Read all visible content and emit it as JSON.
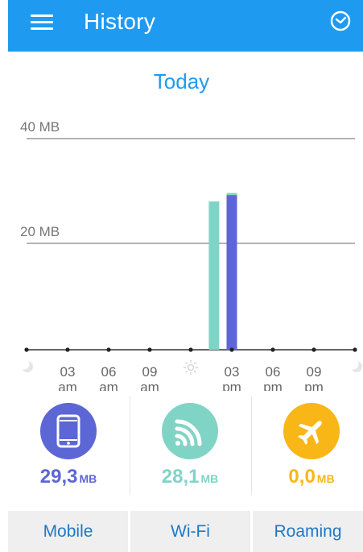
{
  "header": {
    "title": "History",
    "menu_icon": "menu-icon",
    "clock_icon": "clock-icon",
    "background": "#1e9bf0"
  },
  "day_label": "Today",
  "chart_data": {
    "type": "bar",
    "title": "Today",
    "y_ticks": [
      "40 MB",
      "20 MB"
    ],
    "y_tick_values": [
      40,
      20
    ],
    "ylim": [
      0,
      40
    ],
    "x_ticks": [
      {
        "icon": "moon-icon"
      },
      {
        "line1": "03",
        "line2": "am"
      },
      {
        "line1": "06",
        "line2": "am"
      },
      {
        "line1": "09",
        "line2": "am"
      },
      {
        "icon": "sun-icon"
      },
      {
        "line1": "03",
        "line2": "pm"
      },
      {
        "line1": "06",
        "line2": "pm"
      },
      {
        "line1": "09",
        "line2": "pm"
      },
      {
        "icon": "moon-icon"
      }
    ],
    "hours_start": 0,
    "hours_end": 24,
    "series": [
      {
        "name": "Wi-Fi",
        "color": "#80d4c6",
        "hour": 13.7,
        "value": 28.1
      },
      {
        "name": "Mobile",
        "color": "#5c66d4",
        "hour": 15.0,
        "value": 29.3
      }
    ],
    "stack_top": {
      "color": "#80d4c6",
      "value": 0.4
    }
  },
  "stats": [
    {
      "key": "mobile",
      "value": "29,3",
      "unit": "MB",
      "color": "#5c66d4",
      "icon": "phone-icon"
    },
    {
      "key": "wifi",
      "value": "28,1",
      "unit": "MB",
      "color": "#80d4c6",
      "icon": "wifi-icon"
    },
    {
      "key": "roaming",
      "value": "0,0",
      "unit": "MB",
      "color": "#f9b617",
      "icon": "airplane-icon"
    }
  ],
  "tabs": [
    {
      "label": "Mobile"
    },
    {
      "label": "Wi-Fi"
    },
    {
      "label": "Roaming"
    }
  ]
}
